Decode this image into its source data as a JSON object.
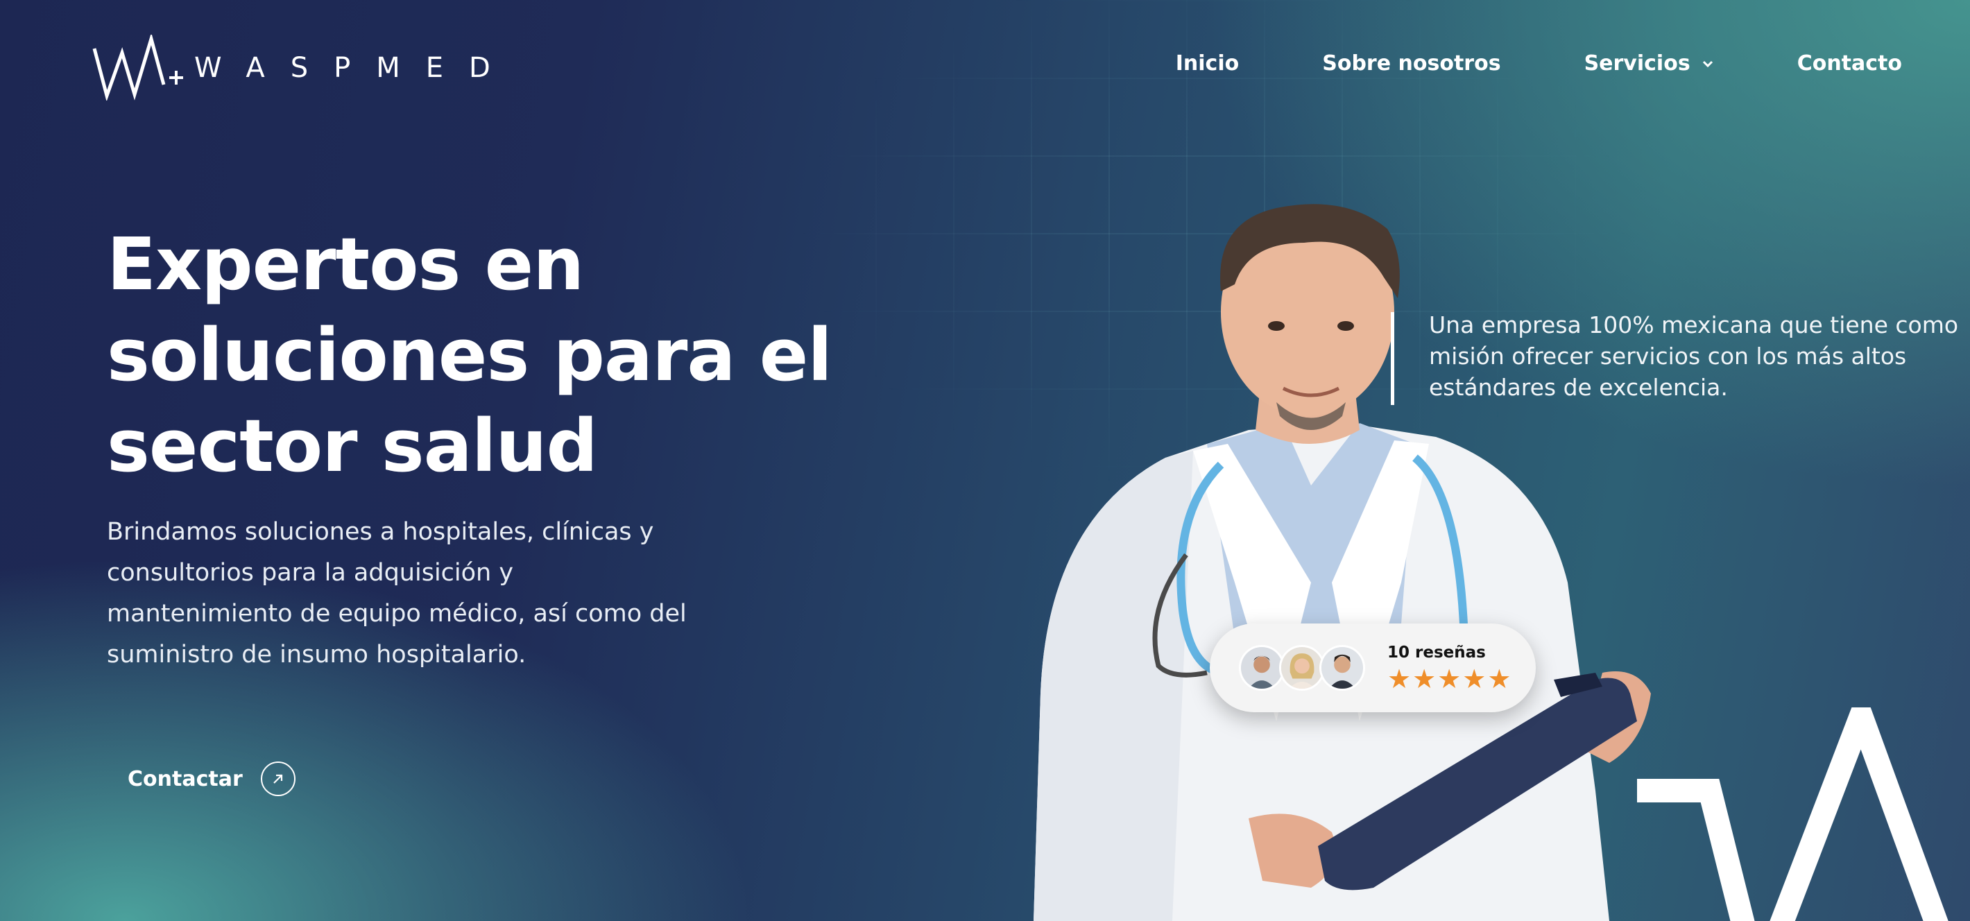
{
  "brand": {
    "name": "WASPMED"
  },
  "nav": {
    "items": [
      {
        "label": "Inicio"
      },
      {
        "label": "Sobre nosotros"
      },
      {
        "label": "Servicios"
      },
      {
        "label": "Contacto"
      }
    ]
  },
  "hero": {
    "title_lines": [
      "Expertos en",
      "soluciones para el",
      "sector salud"
    ],
    "subtitle": "Brindamos soluciones a hospitales, clínicas y consultorios para la adquisición y mantenimiento de equipo médico, así como del suministro de insumo hospitalario.",
    "cta_label": "Contactar"
  },
  "mission": {
    "text": "Una empresa 100% mexicana que tiene como misión ofrecer servicios con los más altos estándares de excelencia."
  },
  "reviews": {
    "count_label": "10 reseñas",
    "stars": [
      "★",
      "★",
      "★",
      "★",
      "★"
    ],
    "rating": 5
  },
  "colors": {
    "navy": "#1d2753",
    "teal": "#45948f",
    "star": "#ef8e2a"
  }
}
